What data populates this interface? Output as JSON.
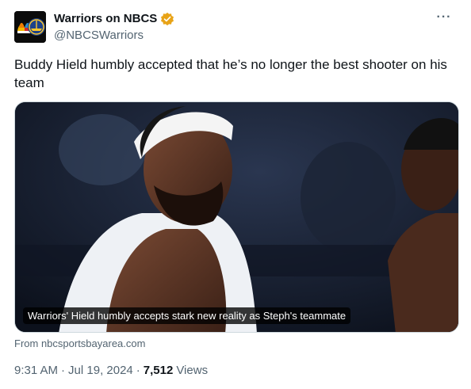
{
  "account": {
    "display_name": "Warriors on NBCS",
    "handle": "@NBCSWarriors",
    "verified": true,
    "badge_color": "#e8a317"
  },
  "more_label": "···",
  "tweet_text": "Buddy Hield humbly accepted that he’s no longer the best shooter on his team",
  "card": {
    "headline": "Warriors' Hield humbly accepts stark new reality as Steph's teammate",
    "source": "From nbcsportsbayarea.com",
    "image_icon": "photo-basketball-player"
  },
  "meta": {
    "time": "9:31 AM",
    "separator": "·",
    "date": "Jul 19, 2024",
    "views_count": "7,512",
    "views_label": "Views"
  },
  "colors": {
    "text_primary": "#0f1419",
    "text_secondary": "#536471",
    "border": "#cfd9de"
  }
}
